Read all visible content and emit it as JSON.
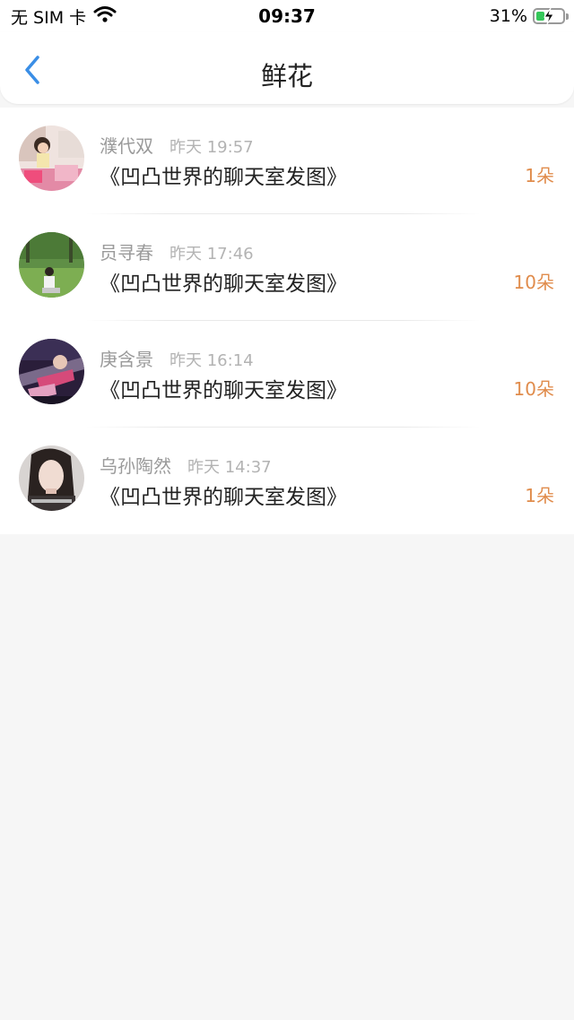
{
  "status_bar": {
    "carrier": "无 SIM 卡",
    "time": "09:37",
    "battery": "31%",
    "battery_level": 0.31
  },
  "nav": {
    "title": "鲜花",
    "back_icon": "chevron-left-icon",
    "accent_color": "#3a8ee6"
  },
  "records": [
    {
      "name": "濮代双",
      "time": "昨天 19:57",
      "message": "《凹凸世界的聊天室发图》",
      "count": "1朵"
    },
    {
      "name": "员寻春",
      "time": "昨天 17:46",
      "message": "《凹凸世界的聊天室发图》",
      "count": "10朵"
    },
    {
      "name": "庚含景",
      "time": "昨天 16:14",
      "message": "《凹凸世界的聊天室发图》",
      "count": "10朵"
    },
    {
      "name": "乌孙陶然",
      "time": "昨天 14:37",
      "message": "《凹凸世界的聊天室发图》",
      "count": "1朵"
    }
  ],
  "colors": {
    "count": "#e08c4c",
    "name": "#9a9a9a",
    "background": "#f6f6f6"
  }
}
